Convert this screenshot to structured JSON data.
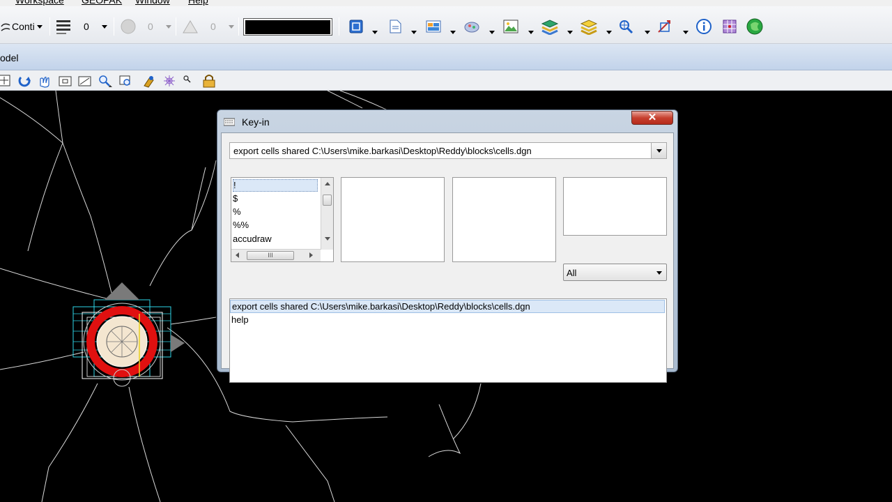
{
  "menu": {
    "items": [
      "Workspace",
      "GEOPAK",
      "Window",
      "Help"
    ]
  },
  "toolbar": {
    "line_style_label": "Conti",
    "level_value": "0",
    "weight_value": "0",
    "transparency_value": "0"
  },
  "view": {
    "title": "odel"
  },
  "dialog": {
    "title": "Key-in",
    "close_label": "✕",
    "keyin_value": "export cells shared C:\\Users\\mike.barkasi\\Desktop\\Reddy\\blocks\\cells.dgn",
    "command_list": [
      "!",
      "$",
      "%",
      "%%",
      "accudraw"
    ],
    "filter_selected": "All",
    "history": [
      "export cells shared C:\\Users\\mike.barkasi\\Desktop\\Reddy\\blocks\\cells.dgn",
      "help"
    ],
    "scroll_thumb_glyph": "III"
  },
  "colors": {
    "canvas_bg": "#000000",
    "accent_blue": "#1f62c9",
    "cell_red": "#e01010",
    "cell_cyan": "#2ed6e8"
  }
}
